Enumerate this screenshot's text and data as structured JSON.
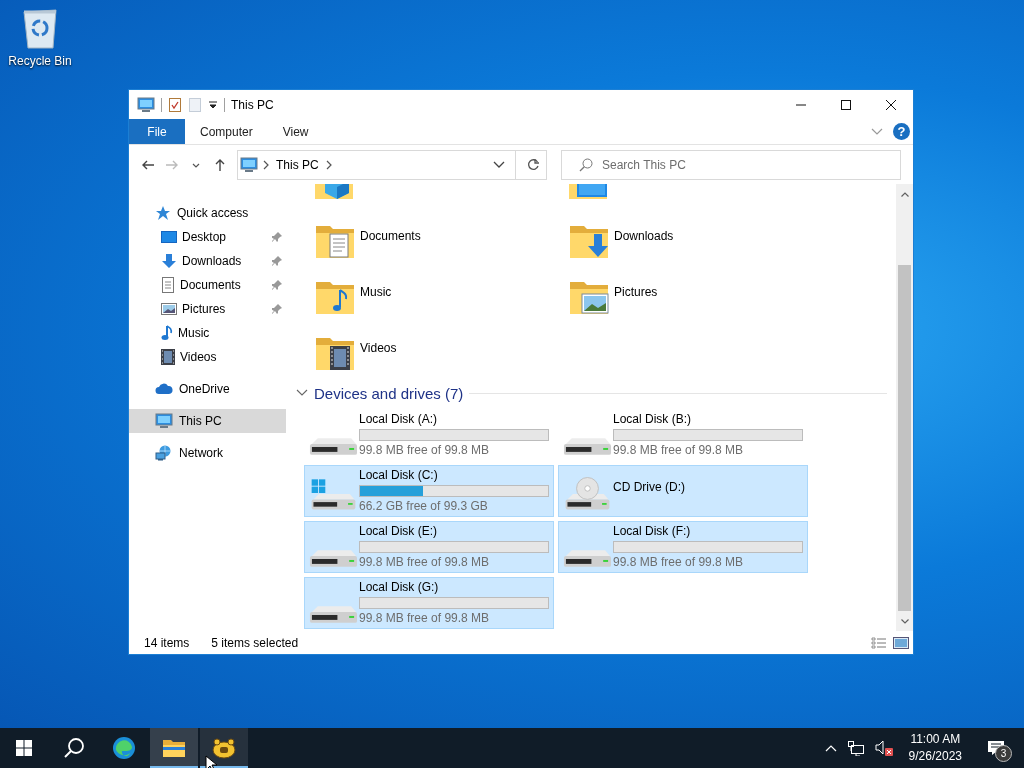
{
  "desktop": {
    "icons": [
      {
        "label": "Recycle Bin",
        "kind": "recycle"
      }
    ]
  },
  "window": {
    "title": "This PC",
    "ribbon_tabs": [
      {
        "label": "File",
        "kind": "file"
      },
      {
        "label": "Computer",
        "kind": "tab"
      },
      {
        "label": "View",
        "kind": "tab"
      }
    ],
    "help": "?",
    "address": {
      "crumbs": [
        "This PC"
      ]
    },
    "search": {
      "placeholder": "Search This PC"
    },
    "navigation": [
      {
        "label": "Quick access",
        "kind": "star",
        "selected": false,
        "children": [
          {
            "label": "Desktop",
            "kind": "desktop",
            "pinned": true,
            "selected": false
          },
          {
            "label": "Downloads",
            "kind": "downloads",
            "pinned": true,
            "selected": false
          },
          {
            "label": "Documents",
            "kind": "documents",
            "pinned": true,
            "selected": false
          },
          {
            "label": "Pictures",
            "kind": "pictures",
            "pinned": true,
            "selected": false
          },
          {
            "label": "Music",
            "kind": "music",
            "pinned": false,
            "selected": false
          },
          {
            "label": "Videos",
            "kind": "videos",
            "pinned": false,
            "selected": false
          }
        ]
      },
      {
        "label": "OneDrive",
        "kind": "cloud",
        "selected": false
      },
      {
        "label": "This PC",
        "kind": "computer",
        "selected": true
      },
      {
        "label": "Network",
        "kind": "network",
        "selected": false
      }
    ],
    "folders": [
      {
        "name": "Documents",
        "kind": "documents"
      },
      {
        "name": "Downloads",
        "kind": "downloads"
      },
      {
        "name": "Music",
        "kind": "music"
      },
      {
        "name": "Pictures",
        "kind": "pictures"
      },
      {
        "name": "Videos",
        "kind": "videos"
      }
    ],
    "drives_group": {
      "title": "Devices and drives (7)",
      "expanded": true
    },
    "drives": [
      {
        "name": "Local Disk (A:)",
        "kind": "hdd",
        "free": "99.8 MB free of 99.8 MB",
        "level": 0,
        "selected": false
      },
      {
        "name": "Local Disk (B:)",
        "kind": "hdd",
        "free": "99.8 MB free of 99.8 MB",
        "level": 0,
        "selected": false
      },
      {
        "name": "Local Disk (C:)",
        "kind": "system",
        "free": "66.2 GB free of 99.3 GB",
        "level": 0.333,
        "selected": true
      },
      {
        "name": "CD Drive (D:)",
        "kind": "cd",
        "selected": true
      },
      {
        "name": "Local Disk (E:)",
        "kind": "hdd",
        "free": "99.8 MB free of 99.8 MB",
        "level": 0,
        "selected": true
      },
      {
        "name": "Local Disk (F:)",
        "kind": "hdd",
        "free": "99.8 MB free of 99.8 MB",
        "level": 0,
        "selected": true
      },
      {
        "name": "Local Disk (G:)",
        "kind": "hdd",
        "free": "99.8 MB free of 99.8 MB",
        "level": 0,
        "selected": true
      }
    ],
    "status_bar": {
      "item_count": "14 items",
      "selection": "5 items selected"
    }
  },
  "taskbar": {
    "apps": [
      {
        "kind": "start",
        "selected": false
      },
      {
        "kind": "search",
        "selected": false
      },
      {
        "kind": "browser",
        "selected": false
      },
      {
        "kind": "explorer",
        "running": true,
        "selected": true
      },
      {
        "kind": "app",
        "running": true,
        "selected": false
      }
    ],
    "tray": {
      "volume_muted": true,
      "time": "11:00 AM",
      "date": "9/26/2023",
      "notifications": "3"
    }
  }
}
